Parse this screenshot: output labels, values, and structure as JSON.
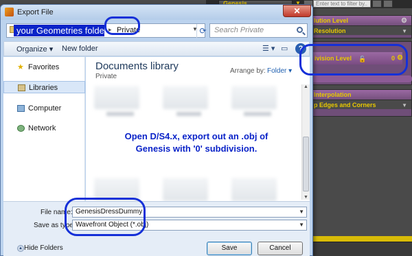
{
  "daz": {
    "node_label": "Genesis",
    "filter_placeholder": "Enter text to filter by..",
    "panels": [
      {
        "header": "lution Level",
        "row": "Resolution"
      },
      {
        "header": "ivision Level",
        "value": "0"
      },
      {
        "header": "Interpolation",
        "row": "p Edges and Corners"
      }
    ]
  },
  "dialog": {
    "title": "Export File",
    "address": {
      "highlighted": "your Geometries folder",
      "crumb": "Private"
    },
    "search_placeholder": "Search Private",
    "toolbar": {
      "organize": "Organize",
      "new_folder": "New folder"
    },
    "nav": [
      {
        "label": "Favorites",
        "icon": "star-icon"
      },
      {
        "label": "Libraries",
        "icon": "libraries-icon"
      },
      {
        "label": "Computer",
        "icon": "computer-icon"
      },
      {
        "label": "Network",
        "icon": "network-icon"
      }
    ],
    "library": {
      "title": "Documents library",
      "subtitle": "Private",
      "arrange_label": "Arrange by:",
      "arrange_value": "Folder"
    },
    "file_name_label": "File name:",
    "file_name_value": "GenesisDressDummy",
    "save_type_label": "Save as type:",
    "save_type_value": "Wavefront Object (*.obj)",
    "hide_folders": "Hide Folders",
    "save_button": "Save",
    "cancel_button": "Cancel"
  },
  "annotation": {
    "line1": "Open D/S4.x, export out an .obj of",
    "line2": "Genesis with '0' subdivision.",
    "color": "#0a23c8"
  }
}
